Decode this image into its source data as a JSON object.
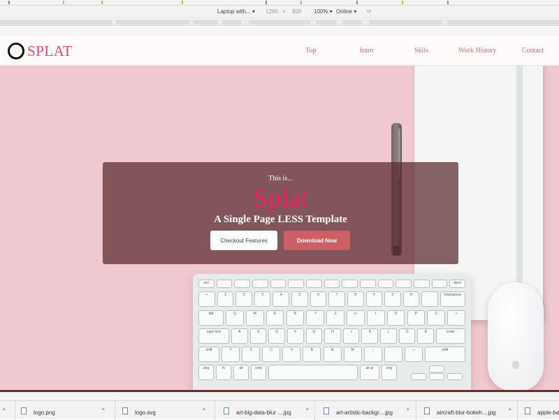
{
  "device_toolbar": {
    "device": "Laptop with...",
    "width": "1280",
    "separator": "×",
    "height": "800",
    "zoom": "100%",
    "network": "Online"
  },
  "site": {
    "logo_text": "SPLAT",
    "nav": [
      "Top",
      "Intro",
      "Skils",
      "Work History",
      "Contact"
    ]
  },
  "hero": {
    "intro": "This is...",
    "title": "Splat",
    "subtitle": "A Single Page LESS Template",
    "checkout_label": "Checkout Features",
    "download_label": "Download Now"
  },
  "keyboard_keys": {
    "row1": [
      "esc",
      "",
      "",
      "",
      "",
      "",
      "",
      "",
      "",
      "",
      "",
      "",
      "",
      "",
      "eject"
    ],
    "row2": [
      "<",
      "1",
      "2",
      "3",
      "4",
      "5",
      "6",
      "7",
      "8",
      "9",
      "0",
      "ß",
      "´",
      "backspace"
    ],
    "row3": [
      "tab",
      "Q",
      "W",
      "E",
      "R",
      "T",
      "Z",
      "U",
      "I",
      "O",
      "P",
      "Ü",
      "+"
    ],
    "row4": [
      "caps lock",
      "A",
      "S",
      "D",
      "F",
      "G",
      "H",
      "J",
      "K",
      "L",
      "Ö",
      "Ä",
      "enter"
    ],
    "row5": [
      "shift",
      "Y",
      "X",
      "C",
      "V",
      "B",
      "N",
      "M",
      ";",
      ":",
      "—",
      "shift"
    ],
    "row6": [
      "strg",
      "fn",
      "alt",
      "cmd",
      "",
      "alt gr",
      "strg"
    ]
  },
  "downloads": [
    {
      "name": "logo.png"
    },
    {
      "name": "logo.svg"
    },
    {
      "name": "art-big-data-blur ....jpg"
    },
    {
      "name": "art-artistic-backgr....jpg"
    },
    {
      "name": "aircraft-blur-bokeh....jpg"
    },
    {
      "name": "apple-ba"
    }
  ],
  "colors": {
    "accent": "#e8245f",
    "nav": "#c76a76",
    "hero_bg": "#efc9cf",
    "download_button": "#cd6066"
  }
}
